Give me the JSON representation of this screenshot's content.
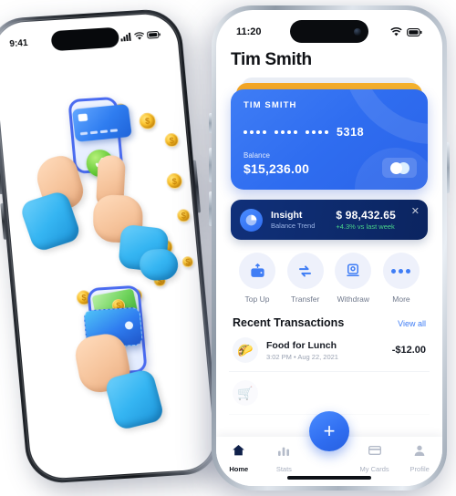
{
  "left_phone": {
    "status": {
      "time": "9:41",
      "signal_icon": "cellular-signal-icon",
      "wifi_icon": "wifi-icon",
      "battery_icon": "battery-icon"
    },
    "illustration": {
      "name": "mobile-payment-3d-illustration",
      "scene_top": "hand holding smartphone with credit card and green success checkmark, finger tapping",
      "scene_bottom": "hand holding smartphone with blue wallet and cash",
      "coin_icon": "gold-coin-icon",
      "check_icon": "check-mark-icon"
    }
  },
  "right_phone": {
    "status": {
      "time": "11:20",
      "wifi_icon": "wifi-icon",
      "battery_icon": "battery-icon"
    },
    "header": {
      "title": "Tim Smith"
    },
    "card": {
      "holder": "TIM SMITH",
      "masked_digits": "•••• •••• ••••",
      "last4": "5318",
      "balance_label": "Balance",
      "balance_value": "$15,236.00",
      "network_icon": "mastercard-icon",
      "front_color": "#2f6df0",
      "mid_color": "#f5a623",
      "back_color": "#e9edf4"
    },
    "insight": {
      "icon": "pie-chart-icon",
      "title": "Insight",
      "subtitle": "Balance Trend",
      "value": "$ 98,432.65",
      "delta": "+4.3% vs last week",
      "delta_color": "#49d48a",
      "close_icon": "close-icon",
      "bg_color": "#0d2a6b"
    },
    "actions": [
      {
        "icon": "wallet-top-up-icon",
        "label": "Top Up"
      },
      {
        "icon": "transfer-arrows-icon",
        "label": "Transfer"
      },
      {
        "icon": "atm-withdraw-icon",
        "label": "Withdraw"
      },
      {
        "icon": "more-dots-icon",
        "label": "More"
      }
    ],
    "transactions": {
      "heading": "Recent Transactions",
      "view_all": "View all",
      "items": [
        {
          "icon": "taco-icon",
          "name": "Food for Lunch",
          "time": "3:02 PM",
          "separator": "•",
          "date": "Aug 22, 2021",
          "amount": "-$12.00"
        },
        {
          "icon": "cart-icon",
          "name": "",
          "time": "",
          "separator": "",
          "date": "",
          "amount": ""
        }
      ]
    },
    "fab": {
      "icon": "plus-icon",
      "color": "#2f6df0"
    },
    "nav": [
      {
        "icon": "home-icon",
        "label": "Home",
        "active": true
      },
      {
        "icon": "stats-bars-icon",
        "label": "Stats",
        "active": false
      },
      {
        "icon": "card-icon",
        "label": "My Cards",
        "active": false
      },
      {
        "icon": "profile-icon",
        "label": "Profile",
        "active": false
      }
    ]
  }
}
